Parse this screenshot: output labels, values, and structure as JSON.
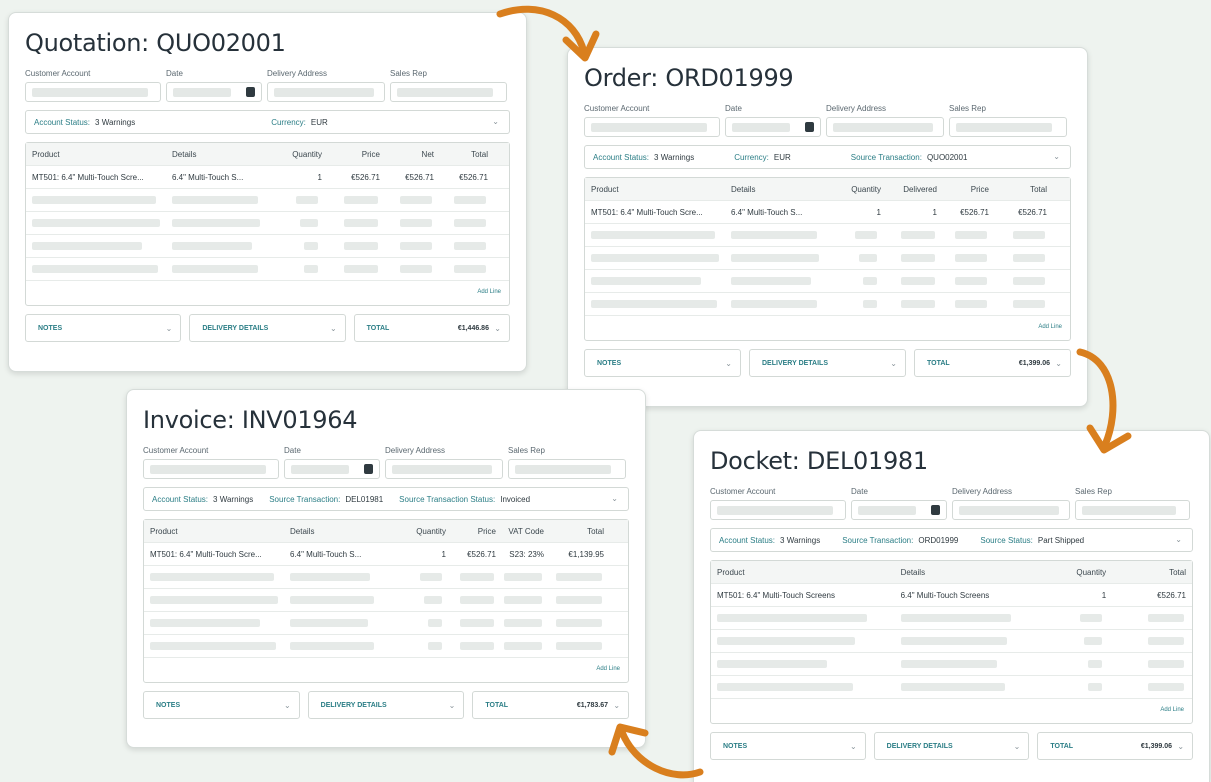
{
  "colors": {
    "accent": "#2b7e86",
    "arrow": "#d97f1e",
    "background": "#eef3ef"
  },
  "quotation": {
    "title": "Quotation: QUO02001",
    "labels": {
      "customer": "Customer Account",
      "date": "Date",
      "delivery": "Delivery Address",
      "rep": "Sales Rep"
    },
    "status": {
      "k1": "Account Status:",
      "v1": "3 Warnings",
      "k2": "Currency:",
      "v2": "EUR"
    },
    "headers": [
      "Product",
      "Details",
      "Quantity",
      "Price",
      "Net",
      "Total"
    ],
    "row": [
      "MT501: 6.4\" Multi-Touch Scre...",
      "6.4\" Multi-Touch S...",
      "1",
      "€526.71",
      "€526.71",
      "€526.71"
    ],
    "add_line": "Add Line",
    "notes": "NOTES",
    "delivery_details": "DELIVERY DETAILS",
    "total_label": "TOTAL",
    "total_value": "€1,446.86"
  },
  "order": {
    "title": "Order: ORD01999",
    "labels": {
      "customer": "Customer Account",
      "date": "Date",
      "delivery": "Delivery Address",
      "rep": "Sales Rep"
    },
    "status": {
      "k1": "Account Status:",
      "v1": "3 Warnings",
      "k2": "Currency:",
      "v2": "EUR",
      "k3": "Source Transaction:",
      "v3": "QUO02001"
    },
    "headers": [
      "Product",
      "Details",
      "Quantity",
      "Delivered",
      "Price",
      "Total"
    ],
    "row": [
      "MT501: 6.4\" Multi-Touch Scre...",
      "6.4\" Multi-Touch S...",
      "1",
      "1",
      "€526.71",
      "€526.71"
    ],
    "add_line": "Add Line",
    "notes": "NOTES",
    "delivery_details": "DELIVERY DETAILS",
    "total_label": "TOTAL",
    "total_value": "€1,399.06"
  },
  "invoice": {
    "title": "Invoice: INV01964",
    "labels": {
      "customer": "Customer Account",
      "date": "Date",
      "delivery": "Delivery Address",
      "rep": "Sales Rep"
    },
    "status": {
      "k1": "Account Status:",
      "v1": "3 Warnings",
      "k2": "Source Transaction:",
      "v2": "DEL01981",
      "k3": "Source Transaction Status:",
      "v3": "Invoiced"
    },
    "headers": [
      "Product",
      "Details",
      "Quantity",
      "Price",
      "VAT Code",
      "Total"
    ],
    "row": [
      "MT501: 6.4\" Multi-Touch Scre...",
      "6.4\" Multi-Touch S...",
      "1",
      "€526.71",
      "S23: 23%",
      "€1,139.95"
    ],
    "add_line": "Add Line",
    "notes": "NOTES",
    "delivery_details": "DELIVERY DETAILS",
    "total_label": "TOTAL",
    "total_value": "€1,783.67"
  },
  "docket": {
    "title": "Docket: DEL01981",
    "labels": {
      "customer": "Customer Account",
      "date": "Date",
      "delivery": "Delivery Address",
      "rep": "Sales Rep"
    },
    "status": {
      "k1": "Account Status:",
      "v1": "3 Warnings",
      "k2": "Source Transaction:",
      "v2": "ORD01999",
      "k3": "Source Status:",
      "v3": "Part Shipped"
    },
    "headers": [
      "Product",
      "Details",
      "Quantity",
      "Total"
    ],
    "row": [
      "MT501: 6.4\" Multi-Touch Screens",
      "6.4\" Multi-Touch Screens",
      "1",
      "€526.71"
    ],
    "add_line": "Add Line",
    "notes": "NOTES",
    "delivery_details": "DELIVERY DETAILS",
    "total_label": "TOTAL",
    "total_value": "€1,399.06"
  }
}
